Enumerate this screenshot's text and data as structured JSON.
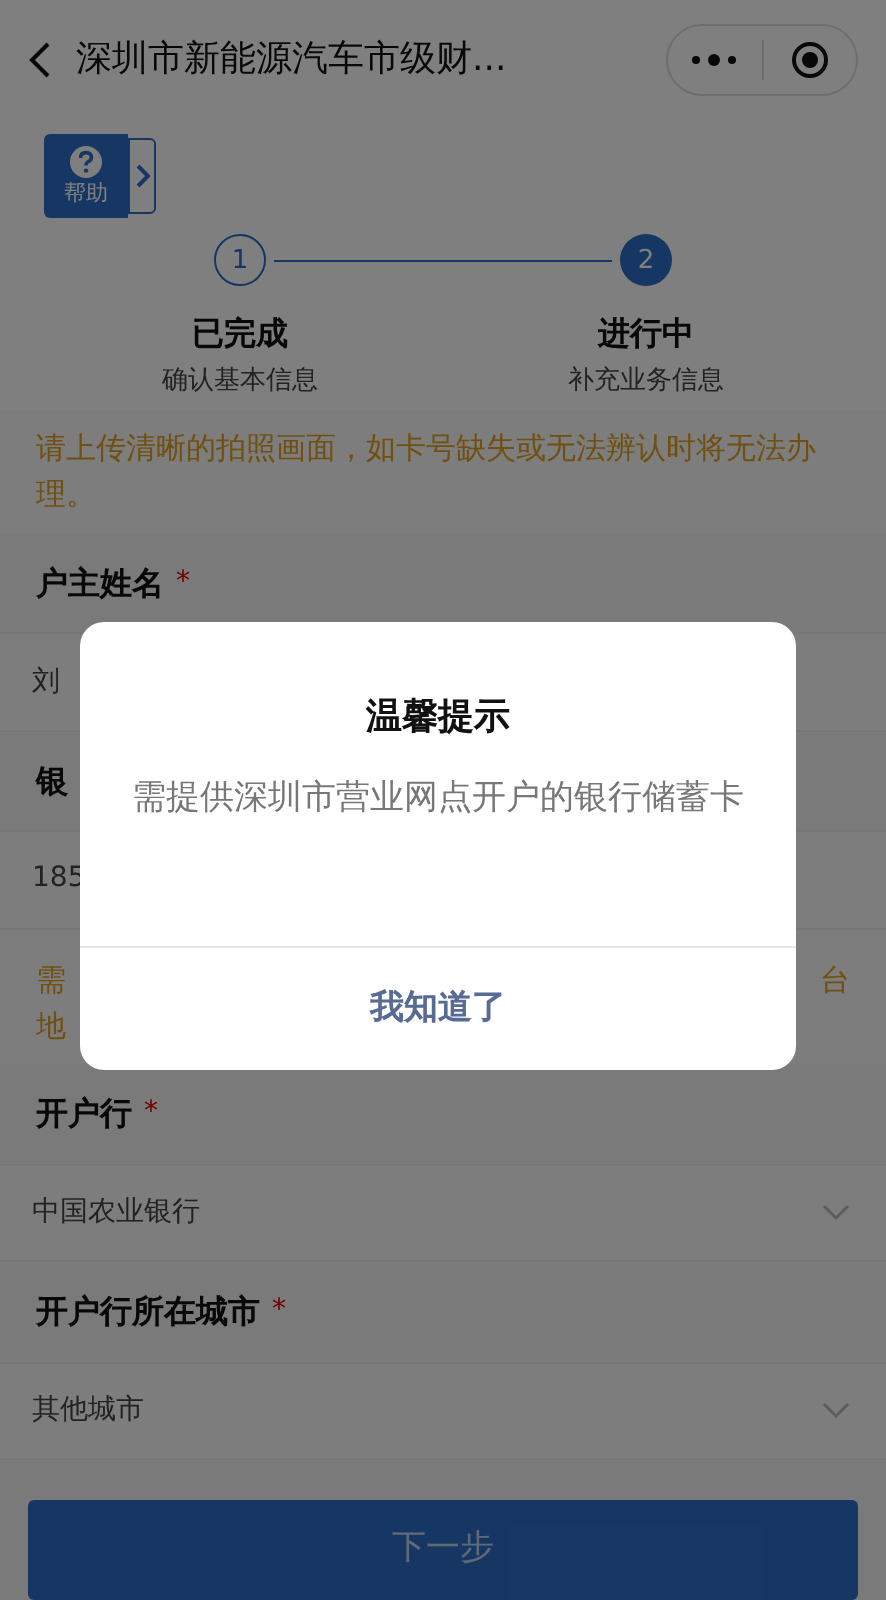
{
  "nav": {
    "title": "深圳市新能源汽车市级财..."
  },
  "help": {
    "label": "帮助"
  },
  "steps": [
    {
      "number": "1",
      "status": "已完成",
      "caption": "确认基本信息",
      "selected": false
    },
    {
      "number": "2",
      "status": "进行中",
      "caption": "补充业务信息",
      "selected": true
    }
  ],
  "notice": "请上传清晰的拍照画面，如卡号缺失或无法辨认时将无法办理。",
  "fields": [
    {
      "label": "户主姓名",
      "required_mark": "*",
      "value": "刘",
      "dropdown": false
    },
    {
      "label": "银",
      "value": "185",
      "dropdown": false
    }
  ],
  "bank_notice": {
    "left_lines": [
      "需",
      "地"
    ],
    "right_line": "台"
  },
  "selects": [
    {
      "label": "开户行",
      "required_mark": "*",
      "value": "中国农业银行",
      "dropdown": true
    },
    {
      "label": "开户行所在城市",
      "required_mark": "*",
      "value": "其他城市",
      "dropdown": true
    }
  ],
  "next_button": "下一步",
  "dialog": {
    "title": "温馨提示",
    "message": "需提供深圳市营业网点开户的银行储蓄卡",
    "button": "我知道了"
  }
}
